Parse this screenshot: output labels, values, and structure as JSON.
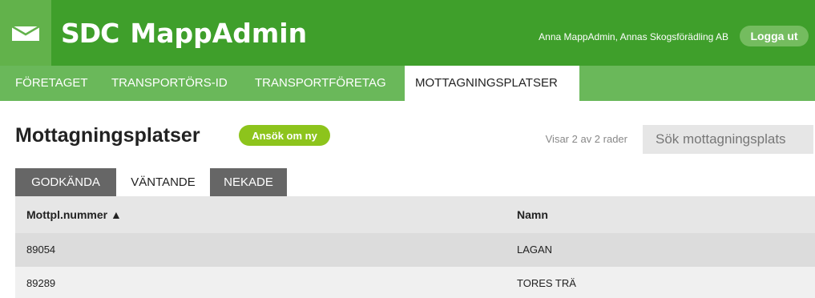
{
  "header": {
    "logo_sdc": "SDC",
    "app_name": "MappAdmin",
    "user_info": "Anna MappAdmin, Annas Skogsförädling AB",
    "logout_label": "Logga ut",
    "colors": {
      "dark_green": "#3f9f2b",
      "light_green": "#6ab85a",
      "mail_block": "#62b24b"
    }
  },
  "nav": {
    "items": [
      {
        "label": "FÖRETAGET",
        "active": false
      },
      {
        "label": "TRANSPORTÖRS-ID",
        "active": false
      },
      {
        "label": "TRANSPORTFÖRETAG",
        "active": false
      },
      {
        "label": "MOTTAGNINGSPLATSER",
        "active": true
      }
    ]
  },
  "main": {
    "title": "Mottagningsplatser",
    "apply_label": "Ansök om ny",
    "row_count": "Visar 2 av 2 rader",
    "search_placeholder": "Sök mottagningsplats",
    "tabs": [
      {
        "label": "GODKÄNDA",
        "active": false
      },
      {
        "label": "VÄNTANDE",
        "active": true
      },
      {
        "label": "NEKADE",
        "active": false
      }
    ],
    "table": {
      "columns": [
        "Mottpl.nummer ▲",
        "Namn"
      ],
      "rows": [
        [
          "89054",
          "LAGAN"
        ],
        [
          "89289",
          "TORES TRÄ"
        ]
      ]
    }
  }
}
